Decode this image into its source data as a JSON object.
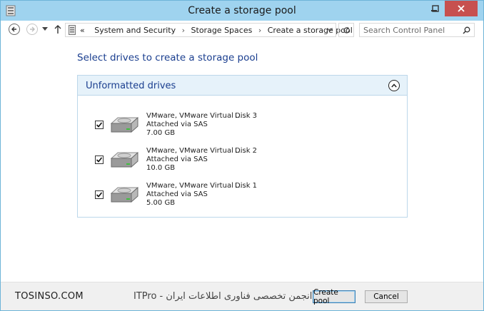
{
  "window": {
    "title": "Create a storage pool"
  },
  "address": {
    "overflow": "«",
    "breadcrumbs": [
      "System and Security",
      "Storage Spaces",
      "Create a storage pool"
    ]
  },
  "search": {
    "placeholder": "Search Control Panel"
  },
  "main": {
    "heading": "Select drives to create a storage pool",
    "section_title": "Unformatted drives",
    "drives": [
      {
        "name": "VMware, VMware Virtual ...",
        "disk": "Disk 3",
        "connection": "Attached via SAS",
        "size": "7.00 GB",
        "checked": true
      },
      {
        "name": "VMware, VMware Virtual ...",
        "disk": "Disk 2",
        "connection": "Attached via SAS",
        "size": "10.0 GB",
        "checked": true
      },
      {
        "name": "VMware, VMware Virtual ...",
        "disk": "Disk 1",
        "connection": "Attached via SAS",
        "size": "5.00 GB",
        "checked": true
      }
    ]
  },
  "footer": {
    "watermark_en": "TOSINSO.COM",
    "watermark_fa": "انجمن تخصصی فناوری اطلاعات ایران - ITPro",
    "create_label": "Create pool",
    "cancel_label": "Cancel"
  },
  "colors": {
    "titlebar": "#9fd3ef",
    "close_button": "#c7504f",
    "heading": "#1a3e8f",
    "panel_header": "#e6f2fa"
  }
}
